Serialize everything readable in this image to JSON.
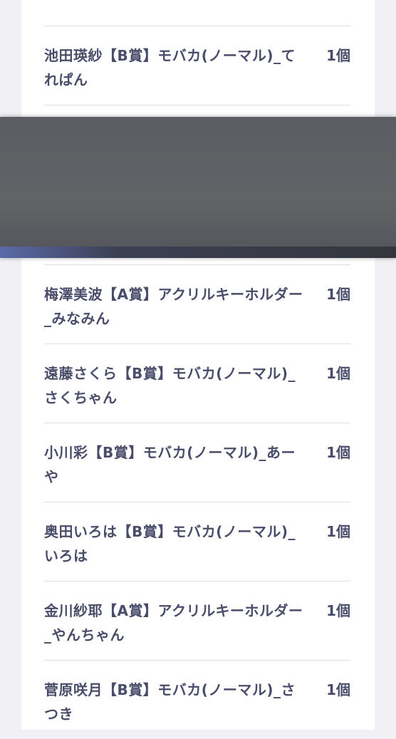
{
  "items": [
    {
      "name": "池田瑛紗【B賞】モバカ(ノーマル)_てれぱん",
      "qty": "1個"
    },
    {
      "name": "梅澤美波【A賞】アクリルキーホルダー_みなみん",
      "qty": "1個"
    },
    {
      "name": "遠藤さくら【B賞】モバカ(ノーマル)_さくちゃん",
      "qty": "1個"
    },
    {
      "name": "小川彩【B賞】モバカ(ノーマル)_あーや",
      "qty": "1個"
    },
    {
      "name": "奥田いろは【B賞】モバカ(ノーマル)_いろは",
      "qty": "1個"
    },
    {
      "name": "金川紗耶【A賞】アクリルキーホルダー_やんちゃん",
      "qty": "1個"
    },
    {
      "name": "菅原咲月【B賞】モバカ(ノーマル)_さつき",
      "qty": "1個"
    }
  ]
}
